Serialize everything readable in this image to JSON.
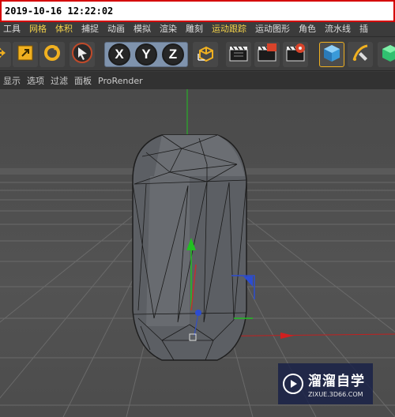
{
  "timestamp": "2019-10-16 12:22:02",
  "menu": {
    "items": [
      {
        "label": "工具",
        "highlight": false
      },
      {
        "label": "网格",
        "highlight": true
      },
      {
        "label": "体积",
        "highlight": true
      },
      {
        "label": "捕捉",
        "highlight": false
      },
      {
        "label": "动画",
        "highlight": false
      },
      {
        "label": "模拟",
        "highlight": false
      },
      {
        "label": "渲染",
        "highlight": false
      },
      {
        "label": "雕刻",
        "highlight": false
      },
      {
        "label": "运动跟踪",
        "highlight": true
      },
      {
        "label": "运动图形",
        "highlight": false
      },
      {
        "label": "角色",
        "highlight": false
      },
      {
        "label": "流水线",
        "highlight": false
      },
      {
        "label": "插",
        "highlight": false
      }
    ]
  },
  "toolbar": {
    "axis_x": "X",
    "axis_y": "Y",
    "axis_z": "Z",
    "icons": [
      "move-icon",
      "scale-icon",
      "rotate-icon",
      "select-icon",
      "x-axis-lock",
      "y-axis-lock",
      "z-axis-lock",
      "coordinate-system-icon",
      "render-view-icon",
      "render-to-picture-viewer-icon",
      "render-settings-icon",
      "cube-icon",
      "pen-icon",
      "green-object-icon"
    ]
  },
  "viewport_menu": {
    "items": [
      "显示",
      "选项",
      "过滤",
      "面板",
      "ProRender"
    ]
  },
  "watermark": {
    "title": "溜溜自学",
    "url": "ZIXUE.3D66.COM"
  },
  "colors": {
    "accent_yellow": "#f3d24a",
    "timestamp_border": "#d40000",
    "axis_group_bg": "#7f93ad",
    "y_axis": "#22c022",
    "x_axis": "#d02020",
    "z_axis": "#2c4cd0"
  }
}
